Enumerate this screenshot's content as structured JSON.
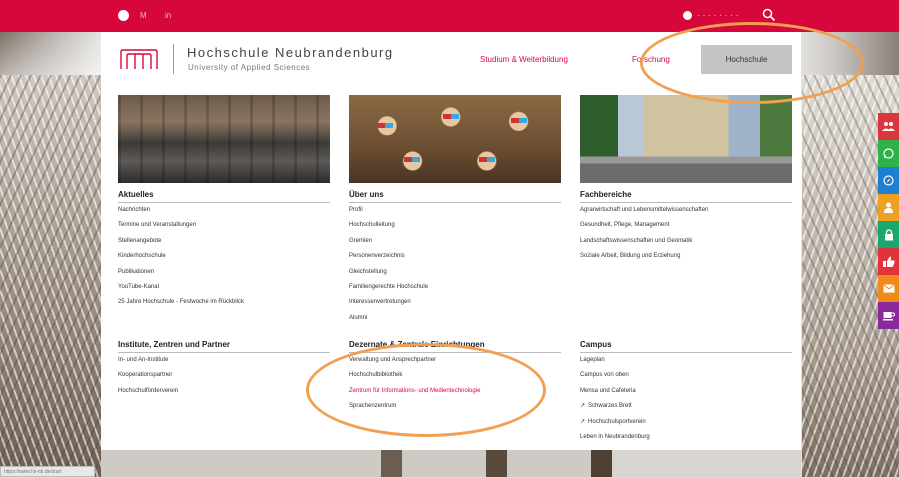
{
  "topbar": {
    "small1": "M",
    "small2": "in",
    "search_partial": "· · · · · · · ·",
    "search_label": "Q"
  },
  "header": {
    "title": "Hochschule Neubrandenburg",
    "subtitle": "University of Applied Sciences",
    "nav": [
      "Studium & Weiterbildung",
      "Forschung",
      "Hochschule"
    ]
  },
  "columns": [
    {
      "heading": "Aktuelles",
      "items": [
        "Nachrichten",
        "Termine und Veranstaltungen",
        "Stellenangebote",
        "Kinderhochschule",
        "Publikationen",
        "YouTube-Kanal",
        "25 Jahre Hochschule - Festwoche im Rückblick"
      ]
    },
    {
      "heading": "Über uns",
      "items": [
        "Profil",
        "Hochschulleitung",
        "Gremien",
        "Personenverzeichnis",
        "Gleichstellung",
        "Familiengerechte Hochschule",
        "Interessenvertretungen",
        "Alumni"
      ]
    },
    {
      "heading": "Fachbereiche",
      "items": [
        "Agrarwirtschaft und Lebensmittelwissenschaften",
        "Gesundheit, Pflege, Management",
        "Landschaftswissenschaften und Geomatik",
        "Soziale Arbeit, Bildung und Erziehung"
      ]
    }
  ],
  "sections2": [
    {
      "heading": "Institute, Zentren und Partner",
      "items": [
        "In- und An-Institute",
        "Kooperationspartner",
        "Hochschulförderverein"
      ]
    },
    {
      "heading": "Dezernate & Zentrale Einrichtungen",
      "items": [
        "Verwaltung und Ansprechpartner",
        "Hochschulbibliothek",
        "Zentrum für Informations- und Medientechnologie",
        "Sprachenzentrum"
      ]
    },
    {
      "heading": "Campus",
      "items": [
        "Lageplan",
        "Campus von oben",
        "Mensa und Cafeteria",
        "Schwarzes Brett",
        "Hochschulsportverein",
        "Leben in Neubrandenburg"
      ]
    }
  ],
  "sidebar": {
    "colors": [
      "#d9363e",
      "#2fb24a",
      "#1e7fd0",
      "#f0a020",
      "#19a86b",
      "#e0343c",
      "#f08a1a",
      "#8a2a9a"
    ],
    "icons": [
      "people-icon",
      "whatsapp-icon",
      "compass-icon",
      "person-icon",
      "lock-icon",
      "thumbs-up-icon",
      "mail-icon",
      "coffee-icon"
    ]
  },
  "status": "https://www.hs-nb.de/start"
}
